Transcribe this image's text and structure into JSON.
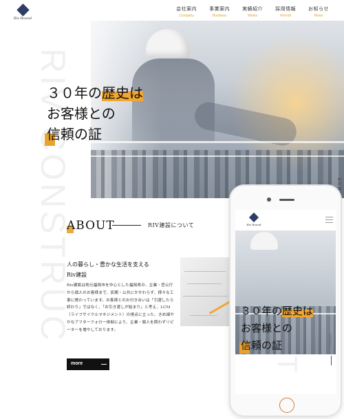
{
  "header": {
    "logo_text": "Riv Round",
    "nav": [
      {
        "jp": "会社案内",
        "en": "Company"
      },
      {
        "jp": "事業案内",
        "en": "Business"
      },
      {
        "jp": "実績紹介",
        "en": "Works"
      },
      {
        "jp": "採用情報",
        "en": "Recruit"
      },
      {
        "jp": "お知らせ",
        "en": "News"
      }
    ]
  },
  "background_text": "RIV CONSTRUC",
  "hero": {
    "line1_a": "３０年の",
    "line1_b": "歴史は",
    "line2": "お客様との",
    "line3": "信頼の証",
    "scroll_label": "SCROLL"
  },
  "about": {
    "title": "ABOUT",
    "subtitle": "RIV建設について",
    "heading_1": "人の暮らし・豊かな生活を支える",
    "heading_2": "Riv建設",
    "body": "Riv建設は地元福岡市を中心とした福岡県の、企業・官公庁から個人のお客様まで、民間・公共にかかわらず、様々な工事に携わっています。お客様とのお付き合いは「引渡したら終わり」ではなく、「お引き渡しが始まり」と考え、LCM（ライフサイクルマネジメント）の視点に立った、きめ細やかなアフターフォロー体制により、企業・個人を問わずリピーターを増やしております。",
    "more_label": "more"
  },
  "phone": {
    "logo_text": "Riv Round",
    "title_line1_a": "３０年の",
    "title_line1_b": "歴史は",
    "title_line2": "お客様との",
    "title_line3": "信頼の証",
    "scroll_label": "SCROLL"
  },
  "colors": {
    "accent": "#e9a22d",
    "logo": "#2c3e63",
    "nav_en": "#e8a12a"
  }
}
